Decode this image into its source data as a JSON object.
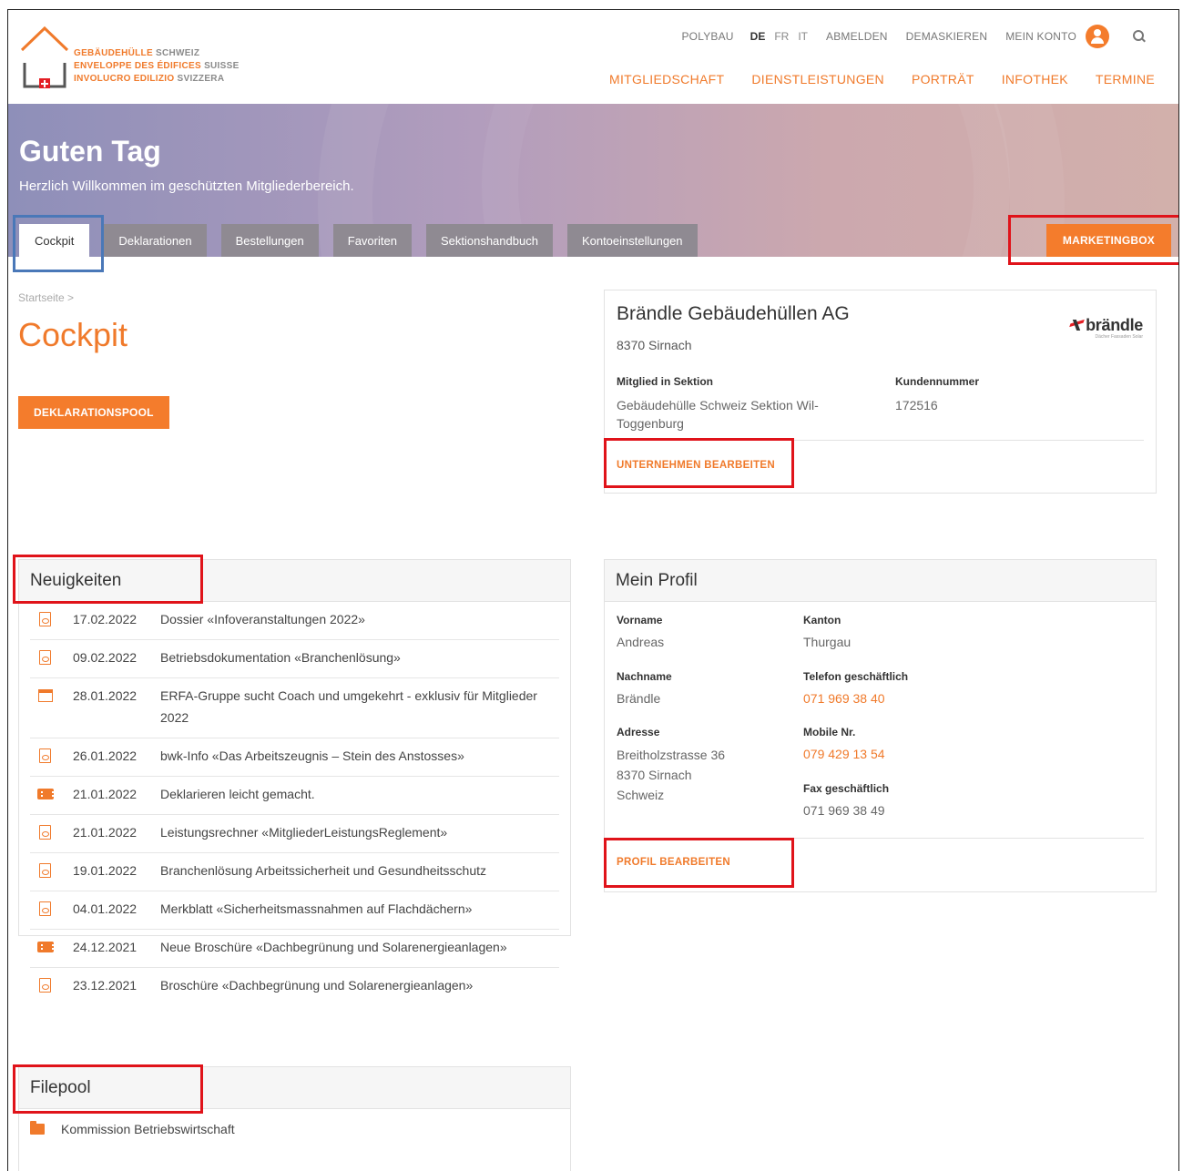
{
  "header": {
    "logo_lines": [
      {
        "a": "GEBÄUDEHÜLLE",
        "b": "SCHWEIZ"
      },
      {
        "a": "ENVELOPPE DES ÉDIFICES",
        "b": "SUISSE"
      },
      {
        "a": "INVOLUCRO EDILIZIO",
        "b": "SVIZZERA"
      }
    ],
    "top_links": {
      "polybau": "POLYBAU",
      "lang_de": "DE",
      "lang_fr": "FR",
      "lang_it": "IT",
      "logout": "ABMELDEN",
      "unmask": "DEMASKIEREN",
      "account": "MEIN KONTO"
    },
    "main_nav": [
      "MITGLIEDSCHAFT",
      "DIENSTLEISTUNGEN",
      "PORTRÄT",
      "INFOTHEK",
      "TERMINE"
    ]
  },
  "hero": {
    "title": "Guten Tag",
    "subtitle": "Herzlich Willkommen im geschützten Mitgliederbereich.",
    "tabs": [
      "Cockpit",
      "Deklarationen",
      "Bestellungen",
      "Favoriten",
      "Sektionshandbuch",
      "Kontoeinstellungen"
    ],
    "marketing_button": "MARKETINGBOX"
  },
  "breadcrumb": "Startseite >",
  "page_title": "Cockpit",
  "decl_button": "DEKLARATIONSPOOL",
  "news": {
    "heading": "Neuigkeiten",
    "items": [
      {
        "icon": "pdf-icon",
        "date": "17.02.2022",
        "title": "Dossier «Infoveranstaltungen 2022»"
      },
      {
        "icon": "word-icon",
        "date": "09.02.2022",
        "title": "Betriebsdokumentation «Branchenlösung»"
      },
      {
        "icon": "calendar-icon",
        "date": "28.01.2022",
        "title": "ERFA-Gruppe sucht Coach und umgekehrt - exklusiv für Mitglieder 2022"
      },
      {
        "icon": "pdf-icon",
        "date": "26.01.2022",
        "title": "bwk-Info «Das Arbeitszeugnis – Stein des Anstosses»"
      },
      {
        "icon": "video-icon",
        "date": "21.01.2022",
        "title": "Deklarieren leicht gemacht."
      },
      {
        "icon": "excel-icon",
        "date": "21.01.2022",
        "title": "Leistungsrechner «MitgliederLeistungsReglement»"
      },
      {
        "icon": "pdf-icon",
        "date": "19.01.2022",
        "title": "Branchenlösung Arbeitssicherheit und Gesundheitsschutz"
      },
      {
        "icon": "pdf-icon",
        "date": "04.01.2022",
        "title": "Merkblatt «Sicherheitsmassnahmen auf Flachdächern»"
      },
      {
        "icon": "video-icon",
        "date": "24.12.2021",
        "title": "Neue Broschüre «Dachbegrünung und Solarenergieanlagen»"
      },
      {
        "icon": "pdf-icon",
        "date": "23.12.2021",
        "title": "Broschüre «Dachbegrünung und Solarenergieanlagen»"
      }
    ]
  },
  "filepool": {
    "heading": "Filepool",
    "items": [
      "Kommission Betriebswirtschaft"
    ]
  },
  "company": {
    "name": "Brändle Gebäudehüllen AG",
    "city": "8370 Sirnach",
    "logo_word": "brändle",
    "logo_tagline": "Dächer Fassaden Solar",
    "section_label": "Mitglied in Sektion",
    "section_value": "Gebäudehülle Schweiz Sektion Wil-Toggenburg",
    "customer_label": "Kundennummer",
    "customer_value": "172516",
    "edit_link": "UNTERNEHMEN BEARBEITEN"
  },
  "profile": {
    "heading": "Mein Profil",
    "firstname_label": "Vorname",
    "firstname": "Andreas",
    "lastname_label": "Nachname",
    "lastname": "Brändle",
    "address_label": "Adresse",
    "address_lines": [
      "Breitholzstrasse 36",
      "8370 Sirnach",
      "Schweiz"
    ],
    "canton_label": "Kanton",
    "canton": "Thurgau",
    "phone_label": "Telefon geschäftlich",
    "phone": "071 969 38 40",
    "mobile_label": "Mobile Nr.",
    "mobile": "079 429 13 54",
    "fax_label": "Fax geschäftlich",
    "fax": "071 969 38 49",
    "edit_link": "PROFIL BEARBEITEN"
  },
  "colors": {
    "accent": "#f07a2b",
    "highlight_red": "#e0131a",
    "highlight_blue": "#4a78b8"
  }
}
